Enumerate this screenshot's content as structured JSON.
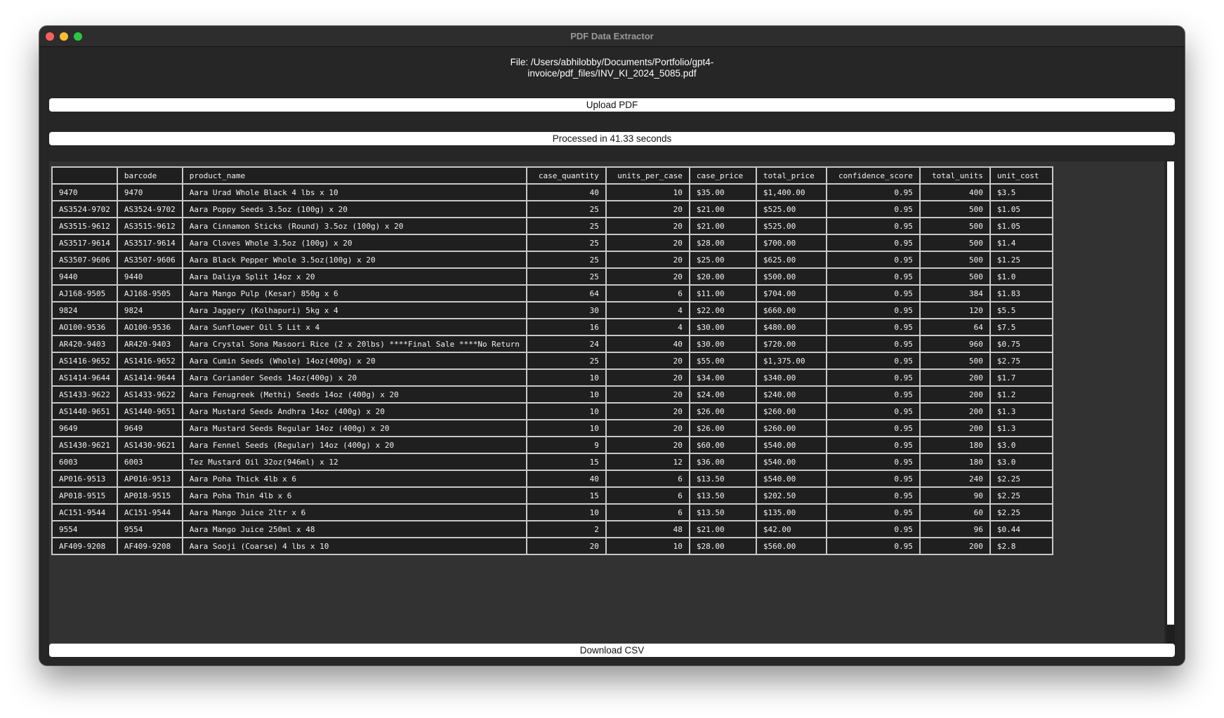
{
  "window": {
    "title": "PDF Data Extractor",
    "file_line1": "File: /Users/abhilobby/Documents/Portfolio/gpt4-",
    "file_line2": "invoice/pdf_files/INV_KI_2024_5085.pdf"
  },
  "buttons": {
    "upload_label": "Upload PDF",
    "download_label": "Download CSV"
  },
  "status_text": "Processed in 41.33 seconds",
  "table": {
    "columns": [
      "",
      "barcode",
      "product_name",
      "case_quantity",
      "units_per_case",
      "case_price",
      "total_price",
      "confidence_score",
      "total_units",
      "unit_cost"
    ],
    "rows": [
      [
        "9470",
        "9470",
        "Aara Urad Whole Black 4 lbs x 10",
        "40",
        "10",
        "$35.00",
        "$1,400.00",
        "0.95",
        "400",
        "$3.5"
      ],
      [
        "AS3524-9702",
        "AS3524-9702",
        "Aara Poppy Seeds 3.5oz (100g) x 20",
        "25",
        "20",
        "$21.00",
        "$525.00",
        "0.95",
        "500",
        "$1.05"
      ],
      [
        "AS3515-9612",
        "AS3515-9612",
        "Aara Cinnamon Sticks (Round) 3.5oz (100g) x 20",
        "25",
        "20",
        "$21.00",
        "$525.00",
        "0.95",
        "500",
        "$1.05"
      ],
      [
        "AS3517-9614",
        "AS3517-9614",
        "Aara Cloves Whole 3.5oz (100g) x 20",
        "25",
        "20",
        "$28.00",
        "$700.00",
        "0.95",
        "500",
        "$1.4"
      ],
      [
        "AS3507-9606",
        "AS3507-9606",
        "Aara Black Pepper Whole 3.5oz(100g) x 20",
        "25",
        "20",
        "$25.00",
        "$625.00",
        "0.95",
        "500",
        "$1.25"
      ],
      [
        "9440",
        "9440",
        "Aara Daliya Split 14oz x 20",
        "25",
        "20",
        "$20.00",
        "$500.00",
        "0.95",
        "500",
        "$1.0"
      ],
      [
        "AJ168-9505",
        "AJ168-9505",
        "Aara Mango Pulp (Kesar) 850g x 6",
        "64",
        "6",
        "$11.00",
        "$704.00",
        "0.95",
        "384",
        "$1.83"
      ],
      [
        "9824",
        "9824",
        "Aara Jaggery (Kolhapuri) 5kg x 4",
        "30",
        "4",
        "$22.00",
        "$660.00",
        "0.95",
        "120",
        "$5.5"
      ],
      [
        "AO100-9536",
        "AO100-9536",
        "Aara Sunflower Oil 5 Lit x 4",
        "16",
        "4",
        "$30.00",
        "$480.00",
        "0.95",
        "64",
        "$7.5"
      ],
      [
        "AR420-9403",
        "AR420-9403",
        "Aara Crystal Sona Masoori Rice (2 x 20lbs) ****Final Sale ****No Return",
        "24",
        "40",
        "$30.00",
        "$720.00",
        "0.95",
        "960",
        "$0.75"
      ],
      [
        "AS1416-9652",
        "AS1416-9652",
        "Aara Cumin Seeds (Whole) 14oz(400g) x 20",
        "25",
        "20",
        "$55.00",
        "$1,375.00",
        "0.95",
        "500",
        "$2.75"
      ],
      [
        "AS1414-9644",
        "AS1414-9644",
        "Aara Coriander Seeds 14oz(400g) x 20",
        "10",
        "20",
        "$34.00",
        "$340.00",
        "0.95",
        "200",
        "$1.7"
      ],
      [
        "AS1433-9622",
        "AS1433-9622",
        "Aara Fenugreek (Methi) Seeds 14oz (400g) x 20",
        "10",
        "20",
        "$24.00",
        "$240.00",
        "0.95",
        "200",
        "$1.2"
      ],
      [
        "AS1440-9651",
        "AS1440-9651",
        "Aara Mustard Seeds Andhra 14oz (400g) x 20",
        "10",
        "20",
        "$26.00",
        "$260.00",
        "0.95",
        "200",
        "$1.3"
      ],
      [
        "9649",
        "9649",
        "Aara Mustard Seeds Regular 14oz (400g) x 20",
        "10",
        "20",
        "$26.00",
        "$260.00",
        "0.95",
        "200",
        "$1.3"
      ],
      [
        "AS1430-9621",
        "AS1430-9621",
        "Aara Fennel Seeds (Regular) 14oz (400g) x 20",
        "9",
        "20",
        "$60.00",
        "$540.00",
        "0.95",
        "180",
        "$3.0"
      ],
      [
        "6003",
        "6003",
        "Tez Mustard Oil 32oz(946ml) x 12",
        "15",
        "12",
        "$36.00",
        "$540.00",
        "0.95",
        "180",
        "$3.0"
      ],
      [
        "AP016-9513",
        "AP016-9513",
        "Aara Poha Thick 4lb x 6",
        "40",
        "6",
        "$13.50",
        "$540.00",
        "0.95",
        "240",
        "$2.25"
      ],
      [
        "AP018-9515",
        "AP018-9515",
        "Aara Poha Thin 4lb x 6",
        "15",
        "6",
        "$13.50",
        "$202.50",
        "0.95",
        "90",
        "$2.25"
      ],
      [
        "AC151-9544",
        "AC151-9544",
        "Aara Mango Juice 2ltr x 6",
        "10",
        "6",
        "$13.50",
        "$135.00",
        "0.95",
        "60",
        "$2.25"
      ],
      [
        "9554",
        "9554",
        "Aara Mango Juice 250ml x 48",
        "2",
        "48",
        "$21.00",
        "$42.00",
        "0.95",
        "96",
        "$0.44"
      ],
      [
        "AF409-9208",
        "AF409-9208",
        "Aara Sooji (Coarse) 4 lbs x 10",
        "20",
        "10",
        "$28.00",
        "$560.00",
        "0.95",
        "200",
        "$2.8"
      ]
    ]
  }
}
